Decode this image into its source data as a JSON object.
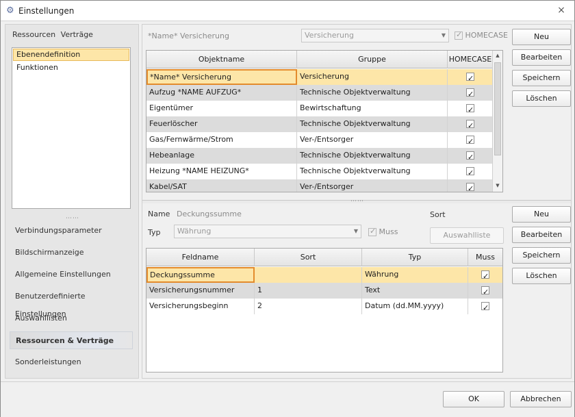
{
  "window": {
    "title": "Einstellungen",
    "close_icon": "×"
  },
  "left": {
    "header": [
      "Ressourcen",
      "Verträge"
    ],
    "list": [
      "Ebenendefinition",
      "Funktionen"
    ],
    "grip": "⋯⋯",
    "nav": [
      "Verbindungsparameter",
      "Bildschirmanzeige",
      "Allgemeine Einstellungen",
      "Benutzerdefinierte Einstellungen",
      "Auswahllisten",
      "Ressourcen & Verträge",
      "Sonderleistungen"
    ]
  },
  "top": {
    "name_label": "*Name* Versicherung",
    "combo_value": "Versicherung",
    "homecase_label": "HOMECASE",
    "buttons": [
      "Neu",
      "Bearbeiten",
      "Speichern",
      "Löschen"
    ],
    "columns": [
      "Objektname",
      "Gruppe",
      "HOMECASE"
    ],
    "rows": [
      {
        "name": "*Name* Versicherung",
        "group": "Versicherung"
      },
      {
        "name": "Aufzug *NAME AUFZUG*",
        "group": "Technische Objektverwaltung"
      },
      {
        "name": "Eigentümer",
        "group": "Bewirtschaftung"
      },
      {
        "name": "Feuerlöscher",
        "group": "Technische Objektverwaltung"
      },
      {
        "name": "Gas/Fernwärme/Strom",
        "group": "Ver-/Entsorger"
      },
      {
        "name": "Hebeanlage",
        "group": "Technische Objektverwaltung"
      },
      {
        "name": "Heizung *NAME HEIZUNG*",
        "group": "Technische Objektverwaltung"
      },
      {
        "name": "Kabel/SAT",
        "group": "Ver-/Entsorger"
      }
    ]
  },
  "bottom": {
    "name_label": "Name",
    "name_value": "Deckungssumme",
    "sort_label": "Sort",
    "typ_label": "Typ",
    "typ_value": "Währung",
    "muss_label": "Muss",
    "auswahlliste": "Auswahlliste",
    "buttons": [
      "Neu",
      "Bearbeiten",
      "Speichern",
      "Löschen"
    ],
    "columns": [
      "Feldname",
      "Sort",
      "Typ",
      "Muss"
    ],
    "rows": [
      {
        "feld": "Deckungssumme",
        "sort": "",
        "typ": "Währung"
      },
      {
        "feld": "Versicherungsnummer",
        "sort": "1",
        "typ": "Text"
      },
      {
        "feld": "Versicherungsbeginn",
        "sort": "2",
        "typ": "Datum (dd.MM.yyyy)"
      }
    ]
  },
  "footer": {
    "ok": "OK",
    "cancel": "Abbrechen"
  },
  "icons": {
    "scroll_up": "▲",
    "scroll_down": "▼",
    "dropdown": "▼",
    "settings": "⚙"
  }
}
